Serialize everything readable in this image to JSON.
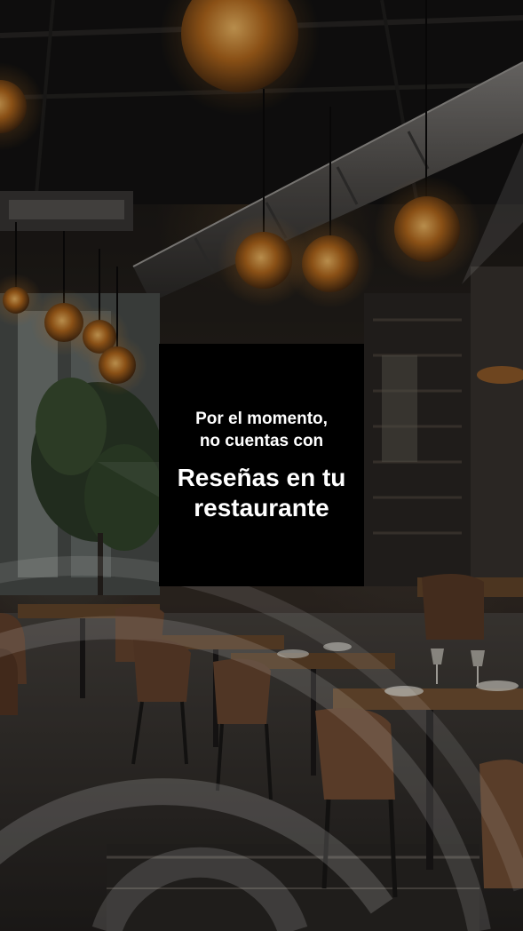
{
  "notice": {
    "intro_line_1": "Por el momento,",
    "intro_line_2": "no cuentas con",
    "title_line_1": "Reseñas en tu",
    "title_line_2": "restaurante"
  },
  "colors": {
    "card_background": "#000000",
    "card_text": "#ffffff",
    "lamp_glow": "#e08a2e",
    "overlay_arcs": "#ffffff"
  },
  "background": {
    "icon": "restaurant-interior-photo"
  }
}
